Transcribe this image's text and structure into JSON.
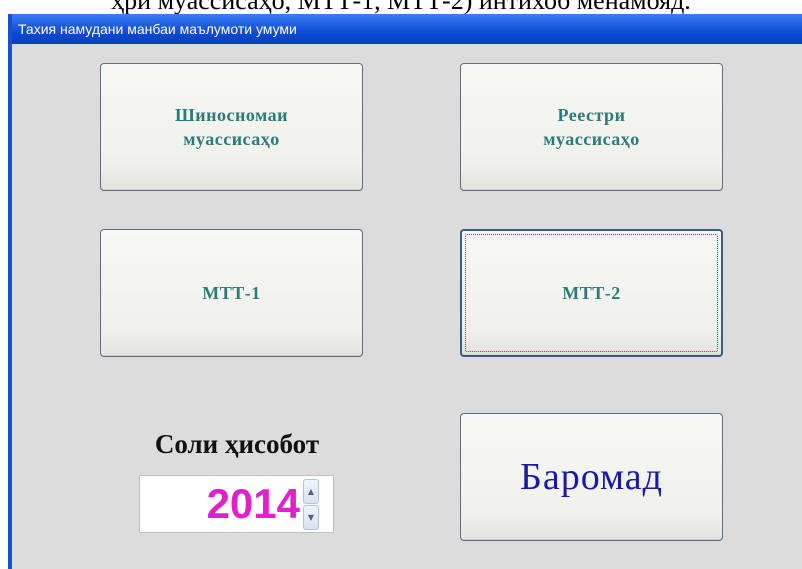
{
  "document": {
    "caption": "ҳри муассисаҳо, МТТ-1, МТТ-2) интихоб менамояд."
  },
  "window": {
    "title": "Тахия намудани манбаи маълумоти умуми"
  },
  "buttons": {
    "registry_card": "Шиносномаи\nмуассисаҳо",
    "registry": "Реестри\nмуассисаҳо",
    "mtt1": "МТТ-1",
    "mtt2": "МТТ-2",
    "exit": "Баромад"
  },
  "report_year": {
    "label": "Соли ҳисобот",
    "value": "2014"
  },
  "icons": {
    "spin_up": "spin-up-arrow",
    "spin_down": "spin-down-arrow"
  },
  "colors": {
    "titlebar": "#0a47d2",
    "button_text": "#2d7a78",
    "exit_text": "#1a1aa6",
    "year_text": "#e020c8",
    "window_bg": "#dcdcdc"
  }
}
